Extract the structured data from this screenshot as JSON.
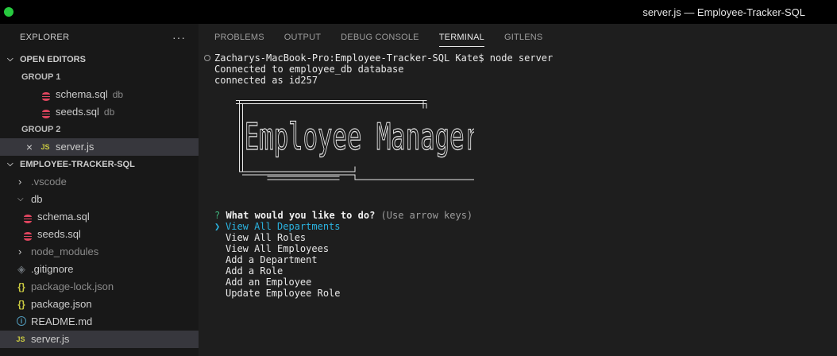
{
  "window": {
    "title": "server.js — Employee-Tracker-SQL"
  },
  "sidebar": {
    "header": "EXPLORER",
    "more_icon": "ellipsis-icon",
    "open_editors": {
      "label": "OPEN EDITORS",
      "group1": "GROUP 1",
      "group1_items": [
        {
          "name": "schema.sql",
          "desc": "db",
          "icon": "database-icon"
        },
        {
          "name": "seeds.sql",
          "desc": "db",
          "icon": "database-icon"
        }
      ],
      "group2": "GROUP 2",
      "group2_items": [
        {
          "name": "server.js",
          "icon_text": "JS",
          "close_icon": "×"
        }
      ]
    },
    "project": {
      "label": "EMPLOYEE-TRACKER-SQL",
      "items": [
        {
          "name": ".vscode",
          "type": "folder-collapsed"
        },
        {
          "name": "db",
          "type": "folder-expanded"
        },
        {
          "name": "schema.sql",
          "type": "file"
        },
        {
          "name": "seeds.sql",
          "type": "file"
        },
        {
          "name": "node_modules",
          "type": "folder-collapsed"
        },
        {
          "name": ".gitignore",
          "type": "file"
        },
        {
          "name": "package-lock.json",
          "type": "file"
        },
        {
          "name": "package.json",
          "type": "file"
        },
        {
          "name": "README.md",
          "type": "file"
        },
        {
          "name": "server.js",
          "type": "file",
          "icon_text": "JS"
        }
      ]
    }
  },
  "panel": {
    "tabs": [
      "PROBLEMS",
      "OUTPUT",
      "DEBUG CONSOLE",
      "TERMINAL",
      "GITLENS"
    ],
    "active_tab": "TERMINAL"
  },
  "terminal": {
    "prompt": "Zacharys-MacBook-Pro:Employee-Tracker-SQL Kate$ node server",
    "output": [
      "Connected to employee_db database",
      "connected as id257"
    ],
    "banner_text": "Employee Manager",
    "question_mark": "?",
    "question": "What would you like to do?",
    "hint": "(Use arrow keys)",
    "pointer": "❯",
    "choices": [
      "View All Departments",
      "View All Roles",
      "View All Employees",
      "Add a Department",
      "Add a Role",
      "Add an Employee",
      "Update Employee Role"
    ],
    "selected_index": 0
  },
  "colors": {
    "accent_selection": "#2bb3e0",
    "prompt_green": "#3fb07a",
    "traffic_green": "#27c93f",
    "db_icon": "#e0455f",
    "js_icon": "#cbcb41"
  }
}
